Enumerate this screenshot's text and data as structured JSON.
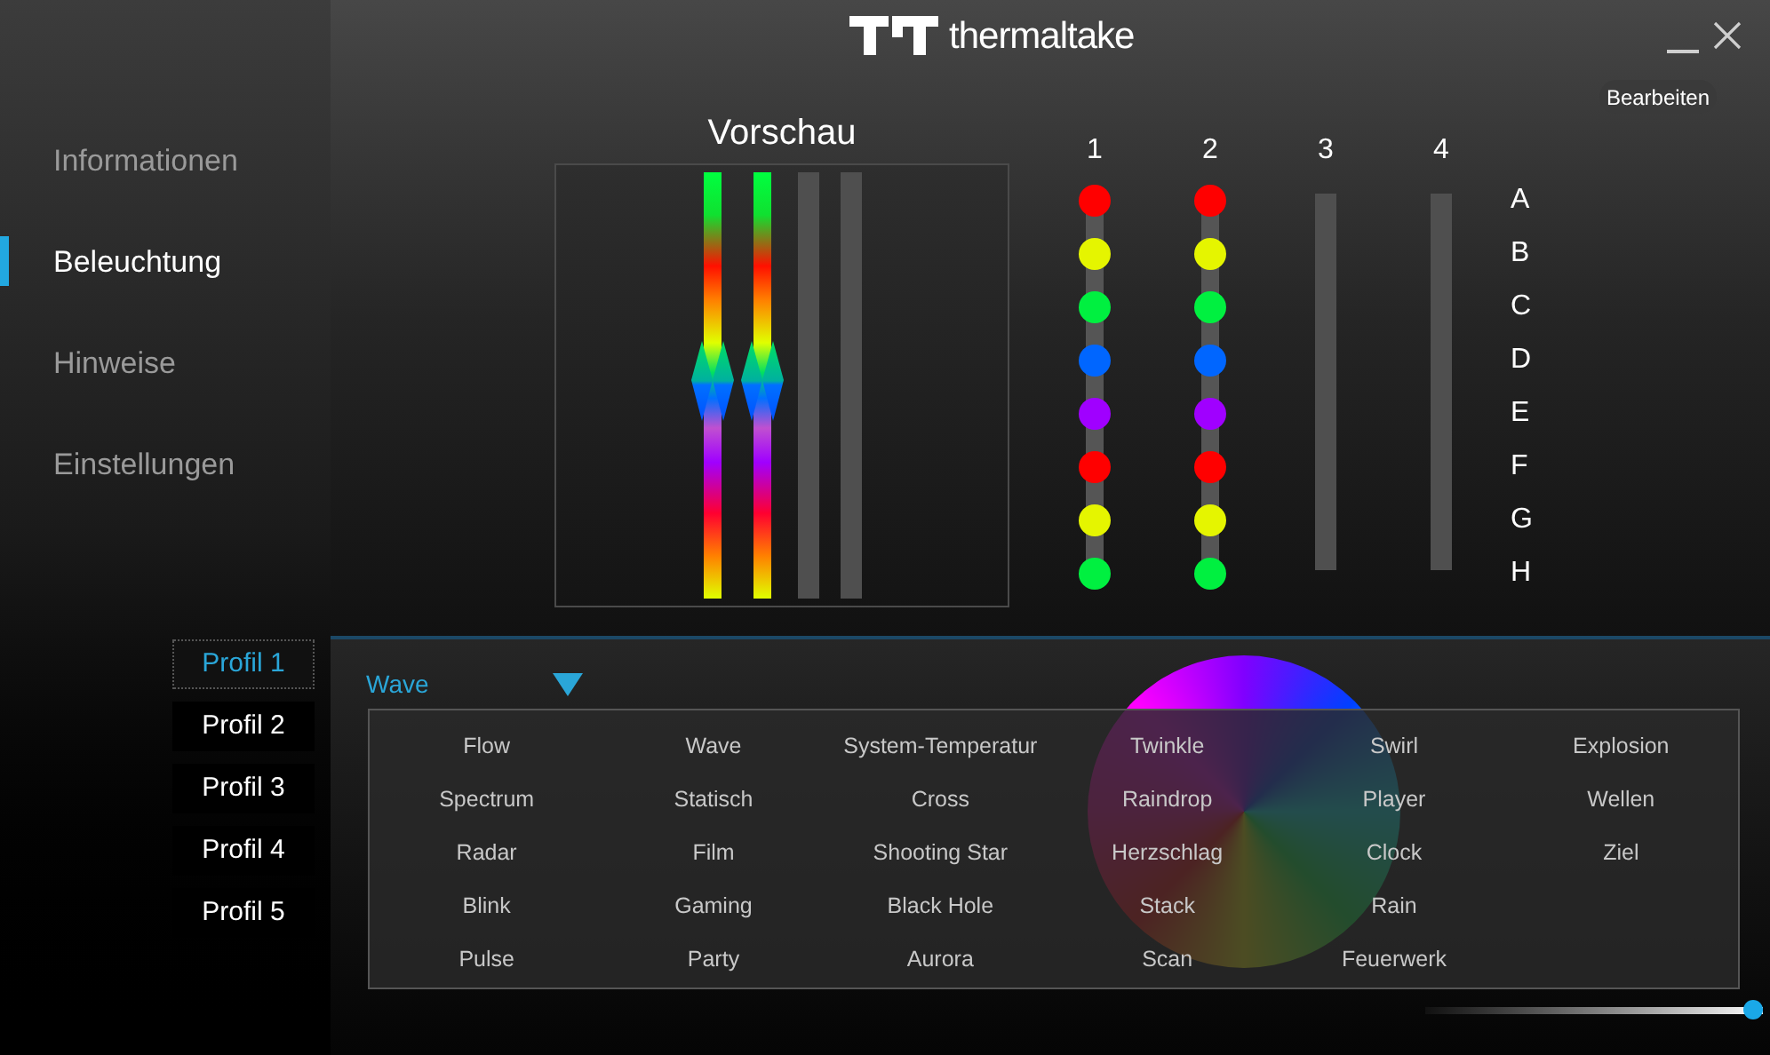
{
  "sidebar": {
    "items": [
      {
        "label": "Informationen",
        "selected": false
      },
      {
        "label": "Beleuchtung",
        "selected": true
      },
      {
        "label": "Hinweise",
        "selected": false
      },
      {
        "label": "Einstellungen",
        "selected": false
      }
    ]
  },
  "profiles": [
    {
      "label": "Profil 1",
      "selected": true
    },
    {
      "label": "Profil 2",
      "selected": false
    },
    {
      "label": "Profil 3",
      "selected": false
    },
    {
      "label": "Profil 4",
      "selected": false
    },
    {
      "label": "Profil 5",
      "selected": false
    }
  ],
  "header": {
    "brand": "thermaltake",
    "edit_button": "Bearbeiten"
  },
  "preview": {
    "title": "Vorschau"
  },
  "channels": [
    {
      "label": "1",
      "leds": [
        {
          "color": "#ff0000"
        },
        {
          "color": "#e5f500"
        },
        {
          "color": "#00f040"
        },
        {
          "color": "#0066ff"
        },
        {
          "color": "#a000ff"
        },
        {
          "color": "#ff0000"
        },
        {
          "color": "#e5f500"
        },
        {
          "color": "#00f040"
        }
      ]
    },
    {
      "label": "2",
      "leds": [
        {
          "color": "#ff0000"
        },
        {
          "color": "#e5f500"
        },
        {
          "color": "#00f040"
        },
        {
          "color": "#0066ff"
        },
        {
          "color": "#a000ff"
        },
        {
          "color": "#ff0000"
        },
        {
          "color": "#e5f500"
        },
        {
          "color": "#00f040"
        }
      ]
    },
    {
      "label": "3"
    },
    {
      "label": "4"
    }
  ],
  "led_labels": [
    "A",
    "B",
    "C",
    "D",
    "E",
    "F",
    "G",
    "H"
  ],
  "effect_dropdown": {
    "value": "Wave"
  },
  "effect_menu": {
    "rows": [
      [
        "Flow",
        "Wave",
        "System-Temperatur",
        "Twinkle",
        "Swirl",
        "Explosion"
      ],
      [
        "Spectrum",
        "Statisch",
        "Cross",
        "Raindrop",
        "Player",
        "Wellen"
      ],
      [
        "Radar",
        "Film",
        "Shooting Star",
        "Herzschlag",
        "Clock",
        "Ziel"
      ],
      [
        "Blink",
        "Gaming",
        "Black Hole",
        "Stack",
        "Rain"
      ],
      [
        "Pulse",
        "Party",
        "Aurora",
        "Scan",
        "Feuerwerk"
      ]
    ]
  },
  "brightness_slider": {
    "level": 1
  }
}
